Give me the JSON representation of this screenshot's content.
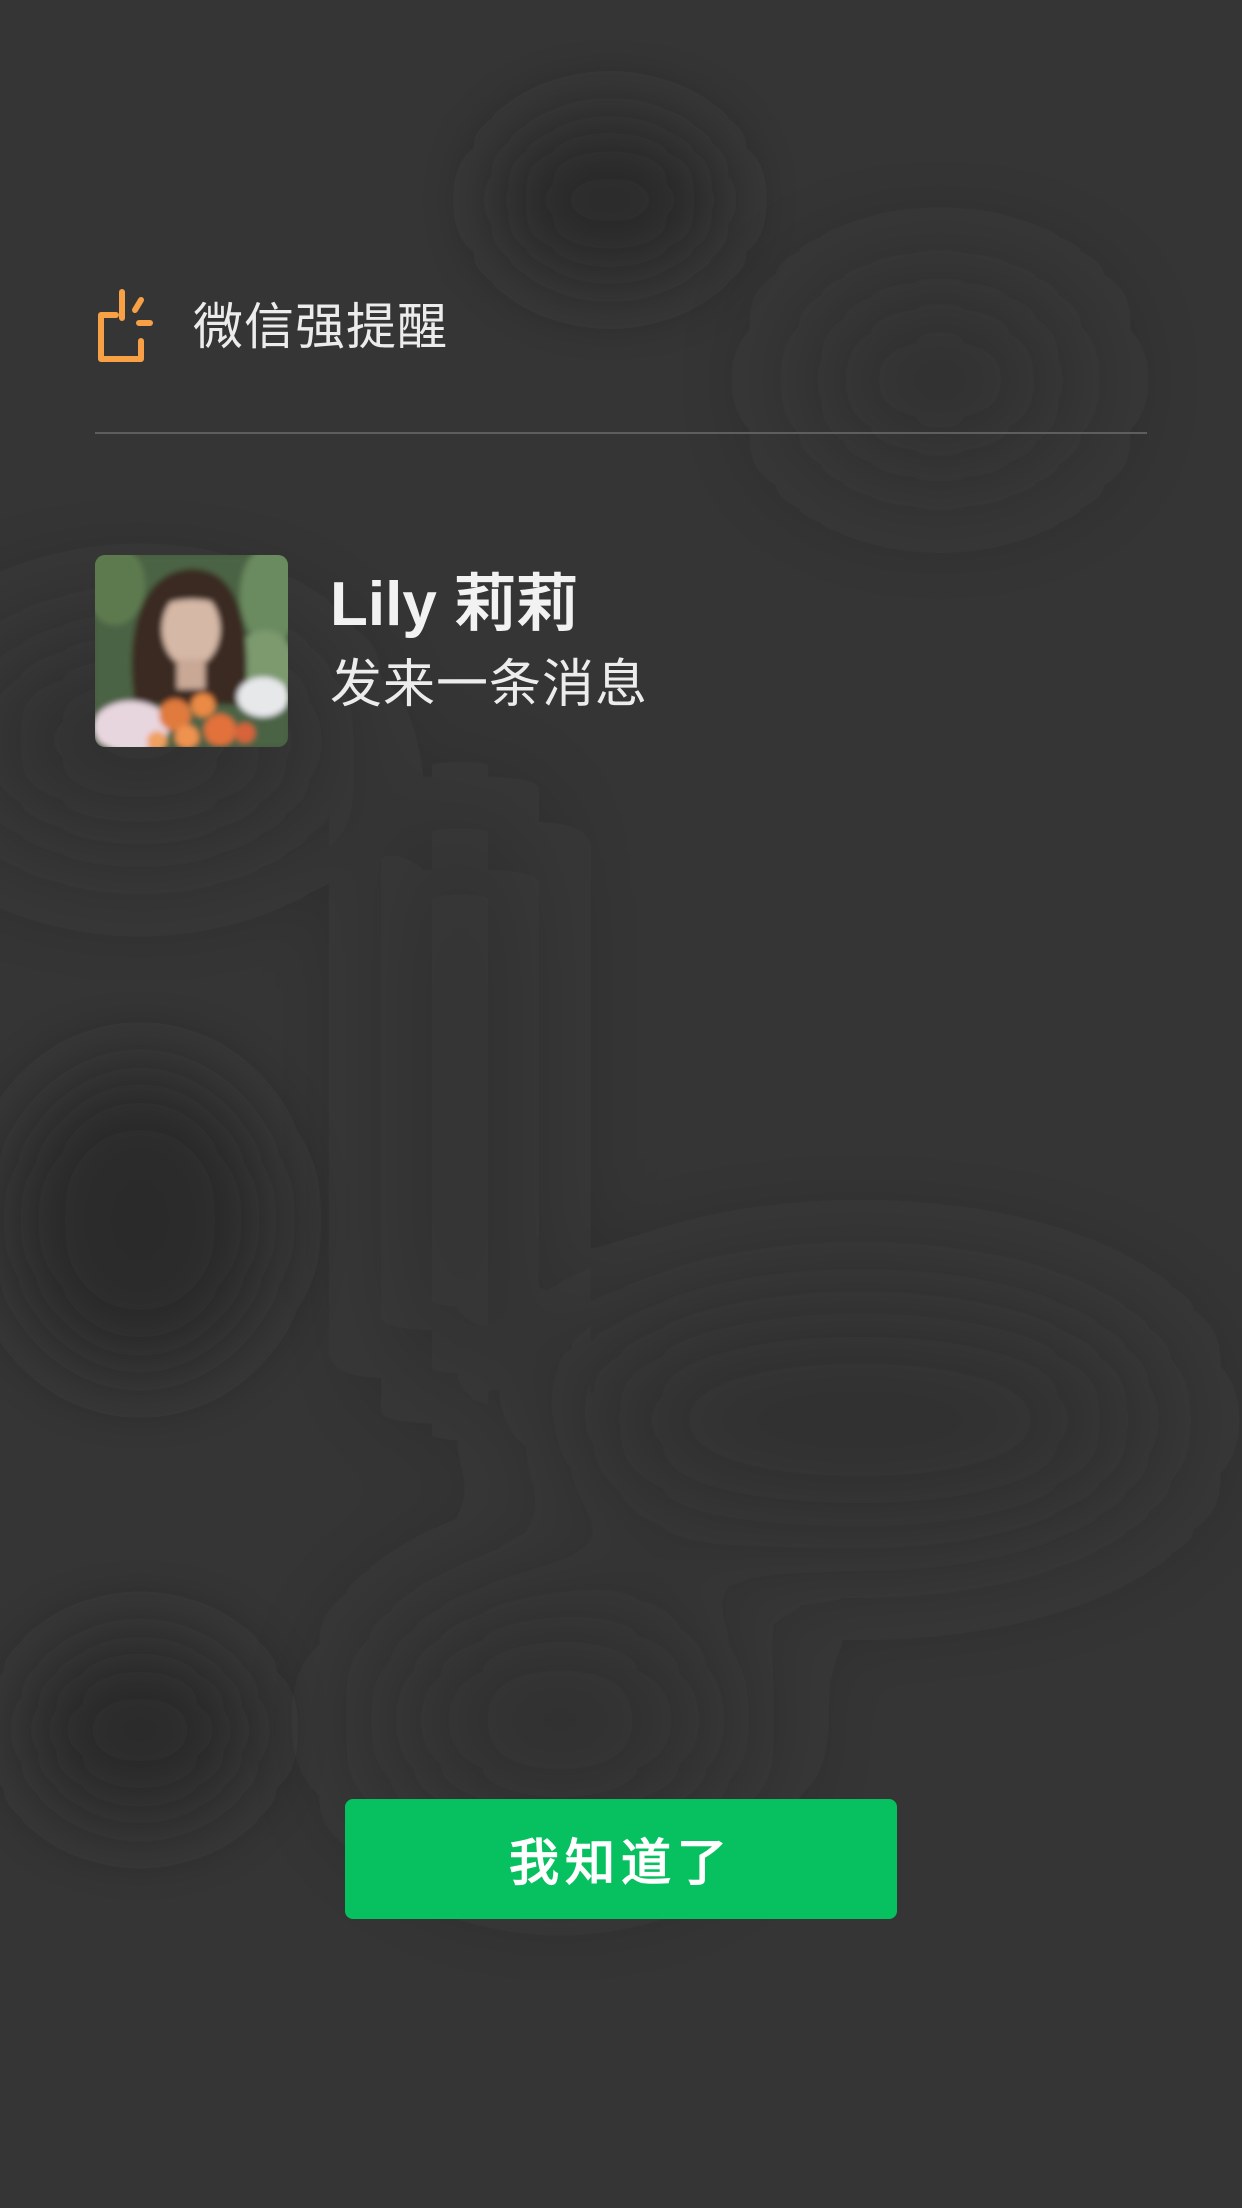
{
  "header": {
    "title": "微信强提醒",
    "icon": "alert-phone-icon",
    "accent_color": "#f7a046"
  },
  "sender": {
    "name": "Lily 莉莉",
    "message": "发来一条消息",
    "avatar": "avatar-photo"
  },
  "actions": {
    "acknowledge_label": "我知道了",
    "acknowledge_color": "#07c160"
  },
  "theme": {
    "background": "#353535",
    "text": "#ececec",
    "divider": "#5e5e5e"
  }
}
